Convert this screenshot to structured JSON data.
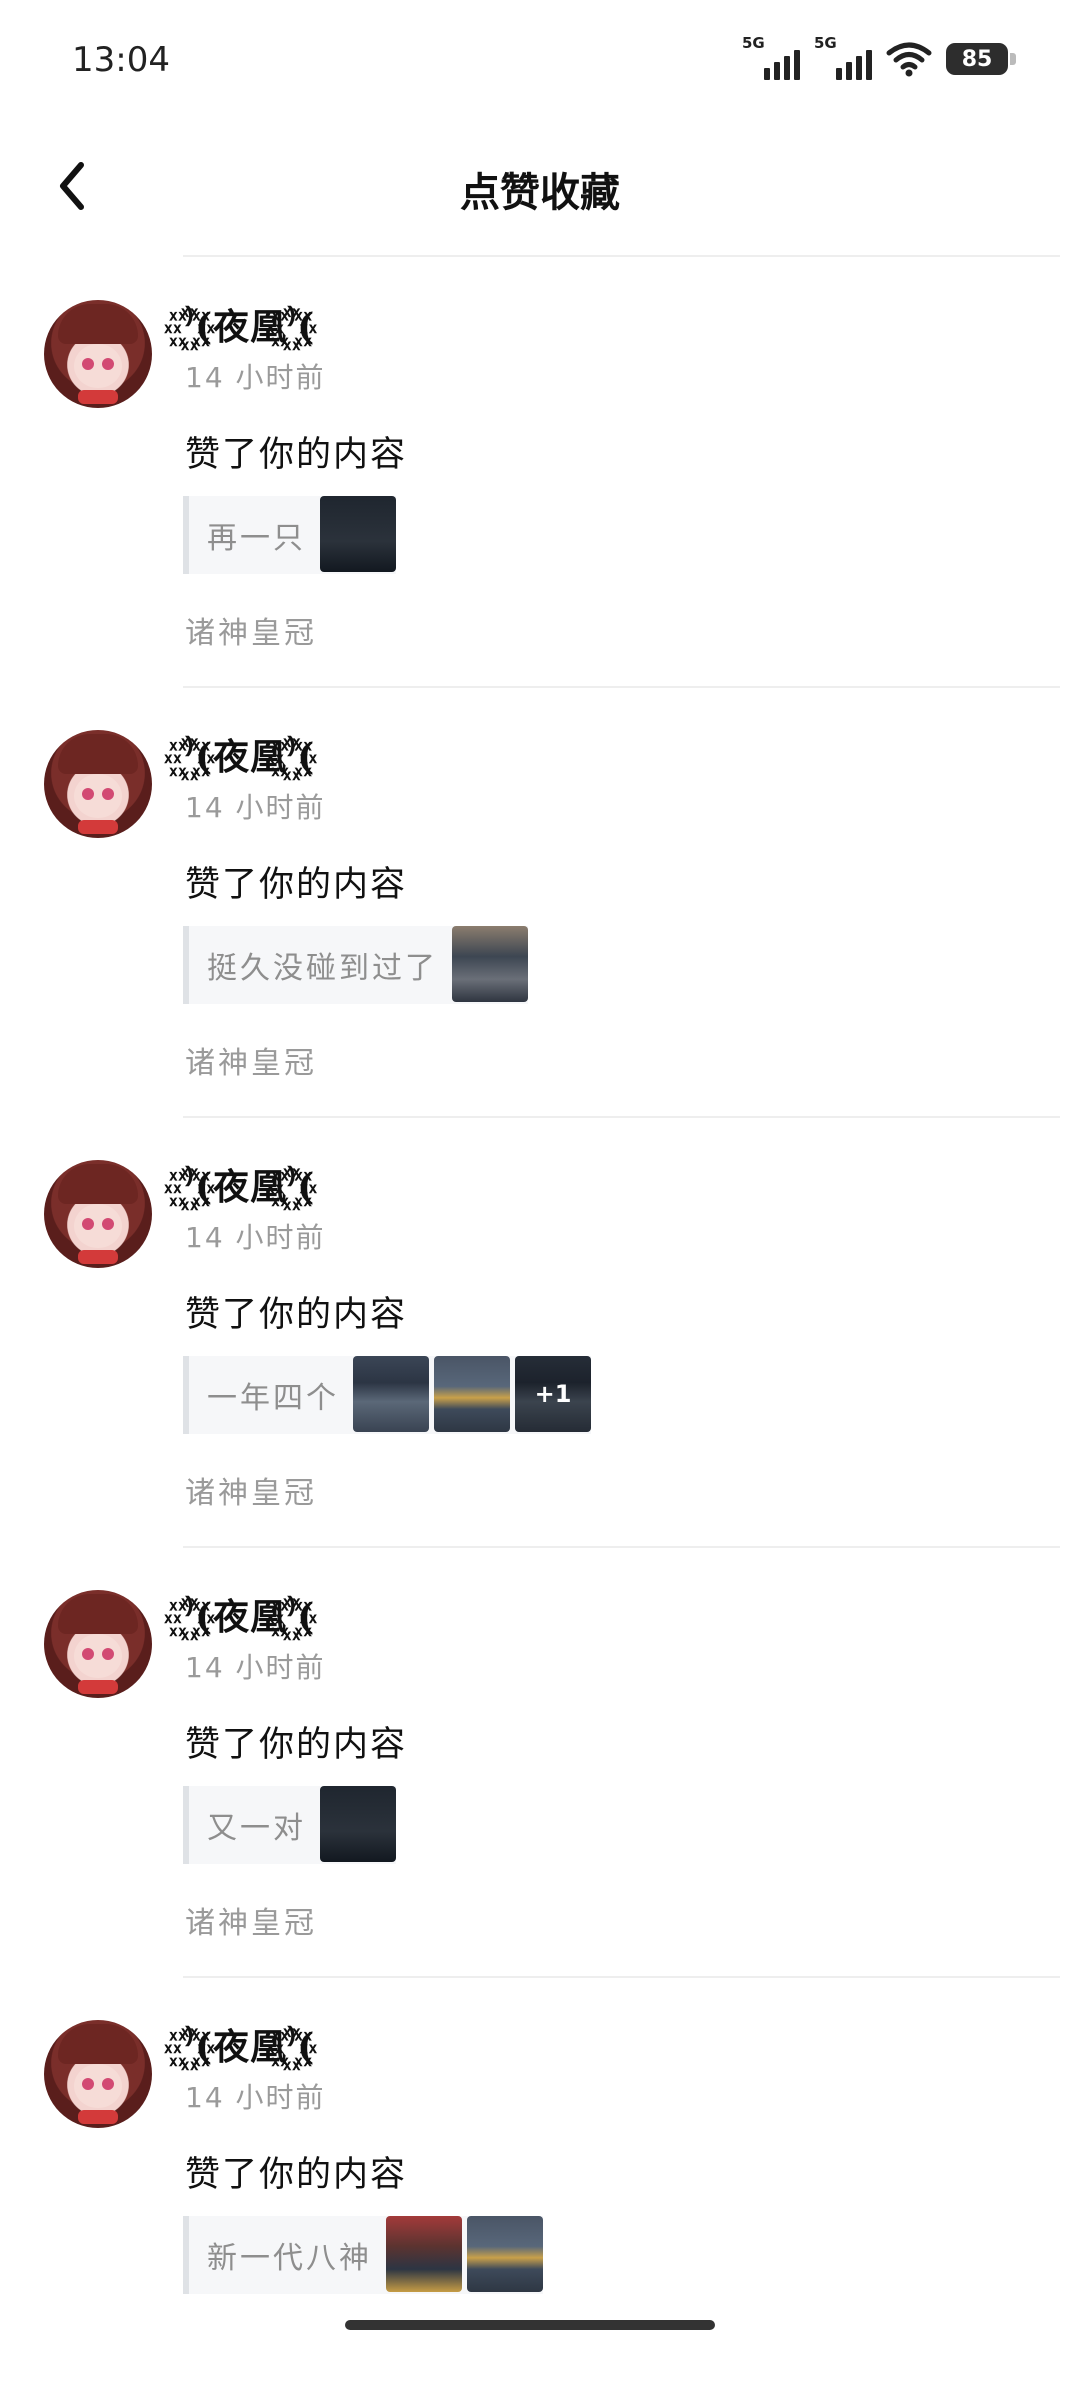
{
  "status_bar": {
    "time": "13:04",
    "signal1_label": "5G",
    "signal2_label": "5G",
    "battery": "85"
  },
  "nav": {
    "title": "点赞收藏"
  },
  "items": [
    {
      "username": "꙰⁾꙰(夜凰꙰⁾꙰(",
      "time": "14 小时前",
      "action": "赞了你的内容",
      "quote": "再一只",
      "thumbs": [
        "dark-screenshot"
      ],
      "circle": "诸神皇冠"
    },
    {
      "username": "꙰⁾꙰(夜凰꙰⁾꙰(",
      "time": "14 小时前",
      "action": "赞了你的内容",
      "quote": "挺久没碰到过了",
      "thumbs": [
        "mid-screenshot"
      ],
      "circle": "诸神皇冠"
    },
    {
      "username": "꙰⁾꙰(夜凰꙰⁾꙰(",
      "time": "14 小时前",
      "action": "赞了你的内容",
      "quote": "一年四个",
      "thumbs": [
        "screenshot",
        "gold-screenshot",
        "screenshot"
      ],
      "more": "+1",
      "circle": "诸神皇冠"
    },
    {
      "username": "꙰⁾꙰(夜凰꙰⁾꙰(",
      "time": "14 小时前",
      "action": "赞了你的内容",
      "quote": "又一对",
      "thumbs": [
        "dark-screenshot"
      ],
      "circle": "诸神皇冠"
    },
    {
      "username": "꙰⁾꙰(夜凰꙰⁾꙰(",
      "time": "14 小时前",
      "action": "赞了你的内容",
      "quote": "新一代八神",
      "thumbs": [
        "red-screenshot",
        "gold-screenshot"
      ],
      "circle": ""
    }
  ],
  "icons": {
    "back": "chevron-left-icon",
    "wifi": "wifi-icon",
    "signal": "cellular-signal-icon",
    "battery": "battery-icon"
  },
  "colors": {
    "secondary_text": "#9a9a9a",
    "divider": "#eeeeee",
    "quote_bg": "#f6f7f9"
  }
}
